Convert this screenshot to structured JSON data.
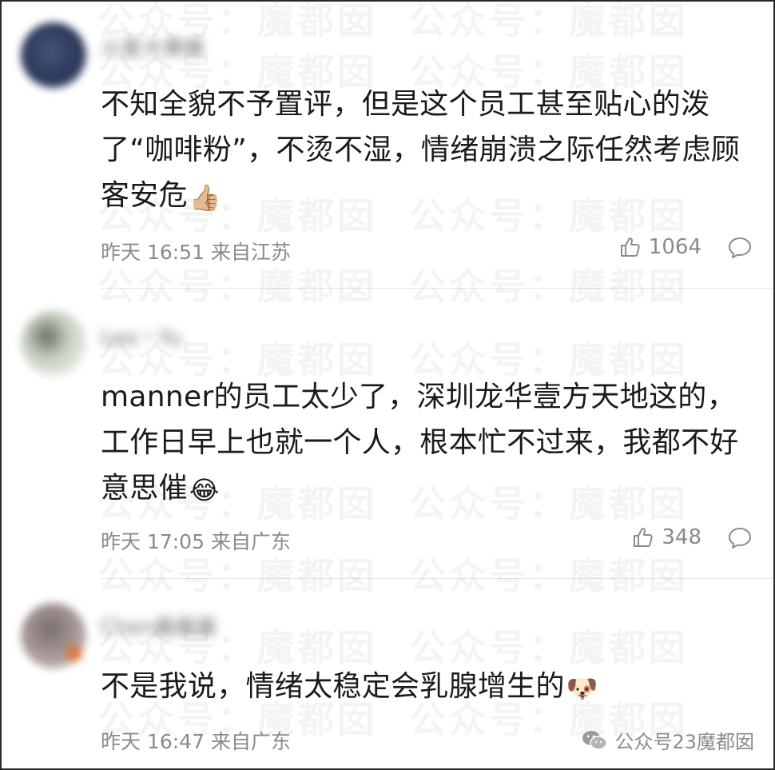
{
  "watermark": {
    "text": "公众号：魔都囡"
  },
  "comments": [
    {
      "username": "火星大黄蜂",
      "text": "不知全貌不予置评，但是这个员工甚至贴心的泼了“咖啡粉”，不烫不湿，情绪崩溃之际任然考虑顾客安危",
      "emoji": "👍🏼",
      "emoji_icon": "thumbs-up-emoji",
      "time": "昨天 16:51",
      "location": "来自江苏",
      "likes": "1064"
    },
    {
      "username": "Leo丶Yu",
      "text": "manner的员工太少了，深圳龙华壹方天地这的，工作日早上也就一个人，根本忙不过来，我都不好意思催",
      "emoji": "😂",
      "emoji_icon": "laughing-tears-emoji",
      "time": "昨天 17:05",
      "location": "来自广东",
      "likes": "348"
    },
    {
      "username": "Chen酱酱酱",
      "text": "不是我说，情绪太稳定会乳腺增生的",
      "emoji": "🐶",
      "emoji_icon": "doge-emoji",
      "time": "昨天 16:47",
      "location": "来自广东",
      "likes": ""
    }
  ],
  "footer": {
    "text": "公众号23魔都囡",
    "icon": "wechat-icon"
  }
}
